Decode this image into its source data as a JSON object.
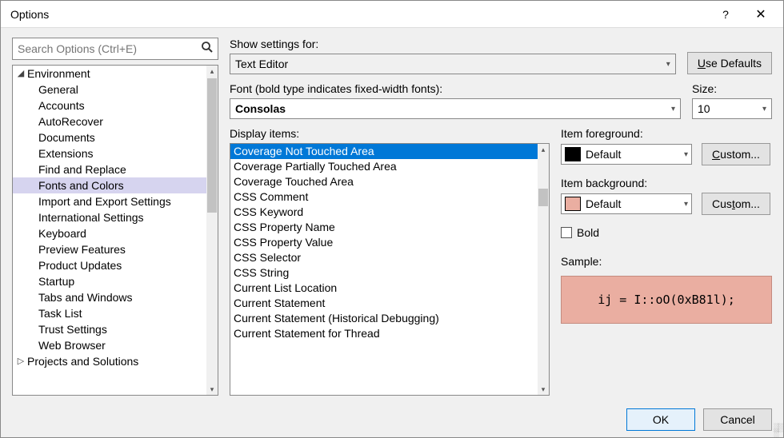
{
  "window": {
    "title": "Options"
  },
  "sidebar": {
    "search_placeholder": "Search Options (Ctrl+E)",
    "tree": [
      {
        "label": "Environment",
        "level": 0,
        "expanded": true
      },
      {
        "label": "General",
        "level": 1
      },
      {
        "label": "Accounts",
        "level": 1
      },
      {
        "label": "AutoRecover",
        "level": 1
      },
      {
        "label": "Documents",
        "level": 1
      },
      {
        "label": "Extensions",
        "level": 1
      },
      {
        "label": "Find and Replace",
        "level": 1
      },
      {
        "label": "Fonts and Colors",
        "level": 1,
        "selected": true
      },
      {
        "label": "Import and Export Settings",
        "level": 1
      },
      {
        "label": "International Settings",
        "level": 1
      },
      {
        "label": "Keyboard",
        "level": 1
      },
      {
        "label": "Preview Features",
        "level": 1
      },
      {
        "label": "Product Updates",
        "level": 1
      },
      {
        "label": "Startup",
        "level": 1
      },
      {
        "label": "Tabs and Windows",
        "level": 1
      },
      {
        "label": "Task List",
        "level": 1
      },
      {
        "label": "Trust Settings",
        "level": 1
      },
      {
        "label": "Web Browser",
        "level": 1
      },
      {
        "label": "Projects and Solutions",
        "level": 0,
        "expanded": false
      }
    ]
  },
  "settingsFor": {
    "label": "Show settings for:",
    "value": "Text Editor",
    "defaults_button": "Use Defaults"
  },
  "font": {
    "label": "Font (bold type indicates fixed-width fonts):",
    "value": "Consolas"
  },
  "size": {
    "label": "Size:",
    "value": "10"
  },
  "displayItems": {
    "label": "Display items:",
    "items": [
      "Coverage Not Touched Area",
      "Coverage Partially Touched Area",
      "Coverage Touched Area",
      "CSS Comment",
      "CSS Keyword",
      "CSS Property Name",
      "CSS Property Value",
      "CSS Selector",
      "CSS String",
      "Current List Location",
      "Current Statement",
      "Current Statement (Historical Debugging)",
      "Current Statement for Thread"
    ],
    "selected_index": 0
  },
  "foreground": {
    "label": "Item foreground:",
    "value": "Default",
    "swatch": "#000000",
    "custom_button": "Custom..."
  },
  "background": {
    "label": "Item background:",
    "value": "Default",
    "swatch": "#eaaea1",
    "custom_button": "Custom..."
  },
  "bold": {
    "label": "Bold",
    "checked": false
  },
  "sample": {
    "label": "Sample:",
    "text": "ij = I::oO(0xB81l);"
  },
  "footer": {
    "ok": "OK",
    "cancel": "Cancel"
  }
}
